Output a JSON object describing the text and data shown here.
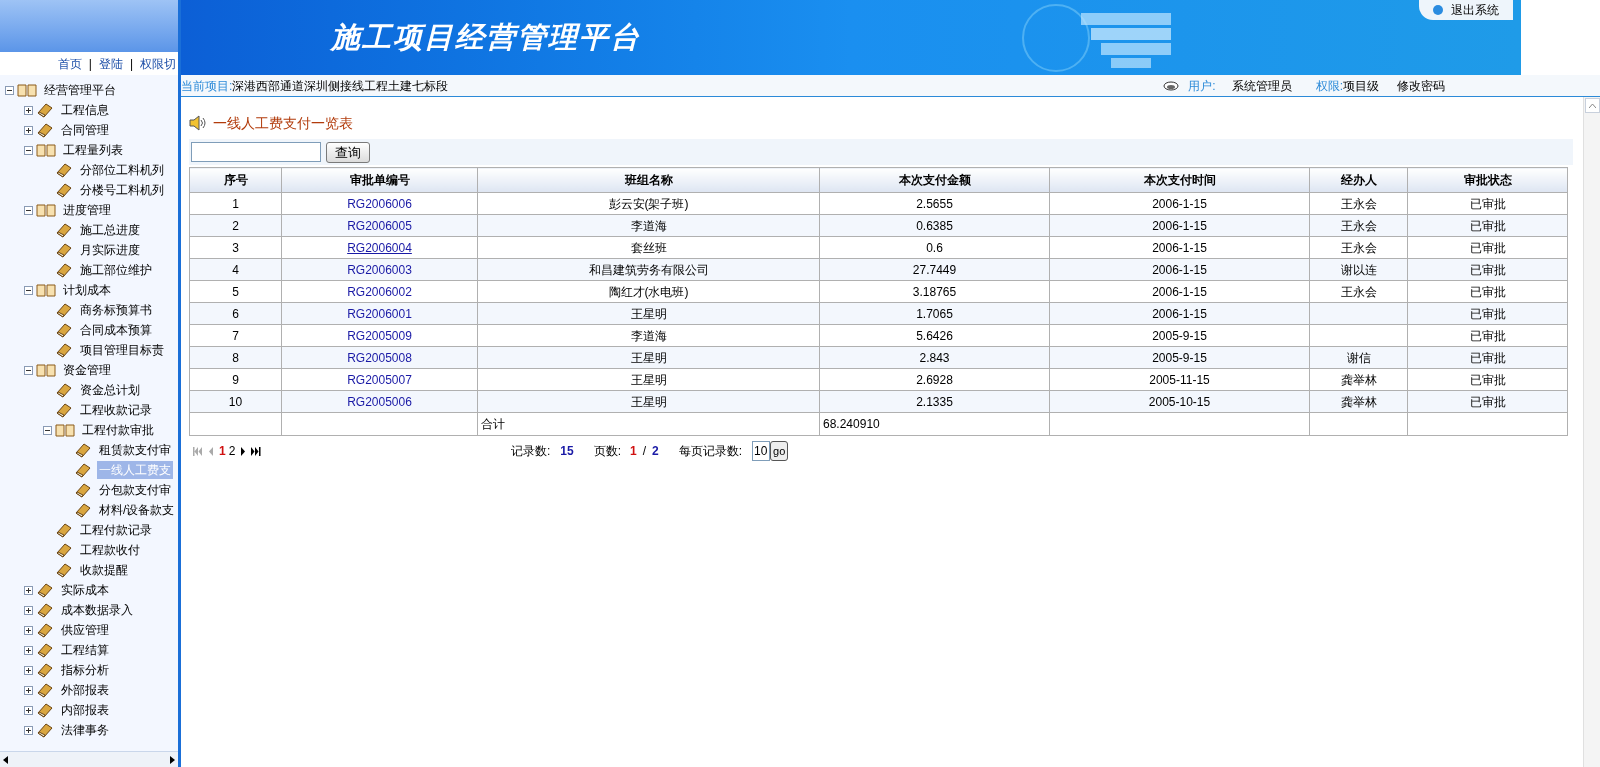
{
  "header": {
    "title": "施工项目经营管理平台",
    "logout": "退出系统"
  },
  "sidebar": {
    "links": [
      "首页",
      "登陆",
      "权限切"
    ],
    "separator": "|",
    "tree": [
      {
        "label": "经营管理平台",
        "expanded": true,
        "selected": false,
        "children": [
          {
            "label": "工程信息",
            "expanded": false,
            "selected": false
          },
          {
            "label": "合同管理",
            "expanded": false,
            "selected": false
          },
          {
            "label": "工程量列表",
            "expanded": true,
            "selected": false,
            "children": [
              {
                "label": "分部位工料机列",
                "selected": false
              },
              {
                "label": "分楼号工料机列",
                "selected": false
              }
            ]
          },
          {
            "label": "进度管理",
            "expanded": true,
            "selected": false,
            "children": [
              {
                "label": "施工总进度",
                "selected": false
              },
              {
                "label": "月实际进度",
                "selected": false
              },
              {
                "label": "施工部位维护",
                "selected": false
              }
            ]
          },
          {
            "label": "计划成本",
            "expanded": true,
            "selected": false,
            "children": [
              {
                "label": "商务标预算书",
                "selected": false
              },
              {
                "label": "合同成本预算",
                "selected": false
              },
              {
                "label": "项目管理目标责",
                "selected": false
              }
            ]
          },
          {
            "label": "资金管理",
            "expanded": true,
            "selected": false,
            "children": [
              {
                "label": "资金总计划",
                "selected": false
              },
              {
                "label": "工程收款记录",
                "selected": false
              },
              {
                "label": "工程付款审批",
                "expanded": true,
                "selected": false,
                "children": [
                  {
                    "label": "租赁款支付审",
                    "selected": false
                  },
                  {
                    "label": "一线人工费支",
                    "selected": true
                  },
                  {
                    "label": "分包款支付审",
                    "selected": false
                  },
                  {
                    "label": "材料/设备款支",
                    "selected": false
                  }
                ]
              },
              {
                "label": "工程付款记录",
                "selected": false
              },
              {
                "label": "工程款收付",
                "selected": false
              },
              {
                "label": "收款提醒",
                "selected": false
              }
            ]
          },
          {
            "label": "实际成本",
            "expanded": false,
            "selected": false
          },
          {
            "label": "成本数据录入",
            "expanded": false,
            "selected": false
          },
          {
            "label": "供应管理",
            "expanded": false,
            "selected": false
          },
          {
            "label": "工程结算",
            "expanded": false,
            "selected": false
          },
          {
            "label": "指标分析",
            "expanded": false,
            "selected": false
          },
          {
            "label": "外部报表",
            "expanded": false,
            "selected": false
          },
          {
            "label": "内部报表",
            "expanded": false,
            "selected": false
          },
          {
            "label": "法律事务",
            "expanded": false,
            "selected": false
          }
        ]
      }
    ]
  },
  "project_bar": {
    "label": "当前项目:",
    "value": "深港西部通道深圳侧接线工程土建七标段",
    "user_label": "用户:",
    "user": "系统管理员",
    "role_label": "权限:",
    "role": "项目级",
    "change_password": "修改密码"
  },
  "page": {
    "title": "一线人工费支付一览表",
    "search": {
      "button": "查询"
    },
    "table": {
      "columns": [
        "序号",
        "审批单编号",
        "班组名称",
        "本次支付金额",
        "本次支付时间",
        "经办人",
        "审批状态"
      ],
      "rows": [
        {
          "no": "1",
          "code": "RG2006006",
          "underlined": false,
          "team": "彭云安(架子班)",
          "amount": "2.5655",
          "date": "2006-1-15",
          "handler": "王永会",
          "status": "已审批"
        },
        {
          "no": "2",
          "code": "RG2006005",
          "underlined": false,
          "team": "李道海",
          "amount": "0.6385",
          "date": "2006-1-15",
          "handler": "王永会",
          "status": "已审批"
        },
        {
          "no": "3",
          "code": "RG2006004",
          "underlined": true,
          "team": "套丝班",
          "amount": "0.6",
          "date": "2006-1-15",
          "handler": "王永会",
          "status": "已审批"
        },
        {
          "no": "4",
          "code": "RG2006003",
          "underlined": false,
          "team": "和昌建筑劳务有限公司",
          "amount": "27.7449",
          "date": "2006-1-15",
          "handler": "谢以连",
          "status": "已审批"
        },
        {
          "no": "5",
          "code": "RG2006002",
          "underlined": false,
          "team": "陶红才(水电班)",
          "amount": "3.18765",
          "date": "2006-1-15",
          "handler": "王永会",
          "status": "已审批"
        },
        {
          "no": "6",
          "code": "RG2006001",
          "underlined": false,
          "team": "王星明",
          "amount": "1.7065",
          "date": "2006-1-15",
          "status": "已审批"
        },
        {
          "no": "7",
          "code": "RG2005009",
          "underlined": false,
          "team": "李道海",
          "amount": "5.6426",
          "date": "2005-9-15",
          "status": "已审批"
        },
        {
          "no": "8",
          "code": "RG2005008",
          "underlined": false,
          "team": "王星明",
          "amount": "2.843",
          "date": "2005-9-15",
          "handler": "谢信",
          "status": "已审批"
        },
        {
          "no": "9",
          "code": "RG2005007",
          "underlined": false,
          "team": "王星明",
          "amount": "2.6928",
          "date": "2005-11-15",
          "handler": "龚举林",
          "status": "已审批"
        },
        {
          "no": "10",
          "code": "RG2005006",
          "underlined": false,
          "team": "王星明",
          "amount": "2.1335",
          "date": "2005-10-15",
          "handler": "龚举林",
          "status": "已审批"
        }
      ],
      "total": {
        "label": "合计",
        "amount": "68.240910"
      }
    },
    "pagination": {
      "pages": [
        {
          "label": "1",
          "selected": true
        },
        {
          "label": "2",
          "selected": false
        }
      ],
      "records_label": "记录数:",
      "records": "15",
      "pages_label": "页数:",
      "current_page": "1",
      "separator": "/",
      "total_pages": "2",
      "per_page_label": "每页记录数:",
      "per_page": "10",
      "go": "go"
    }
  }
}
